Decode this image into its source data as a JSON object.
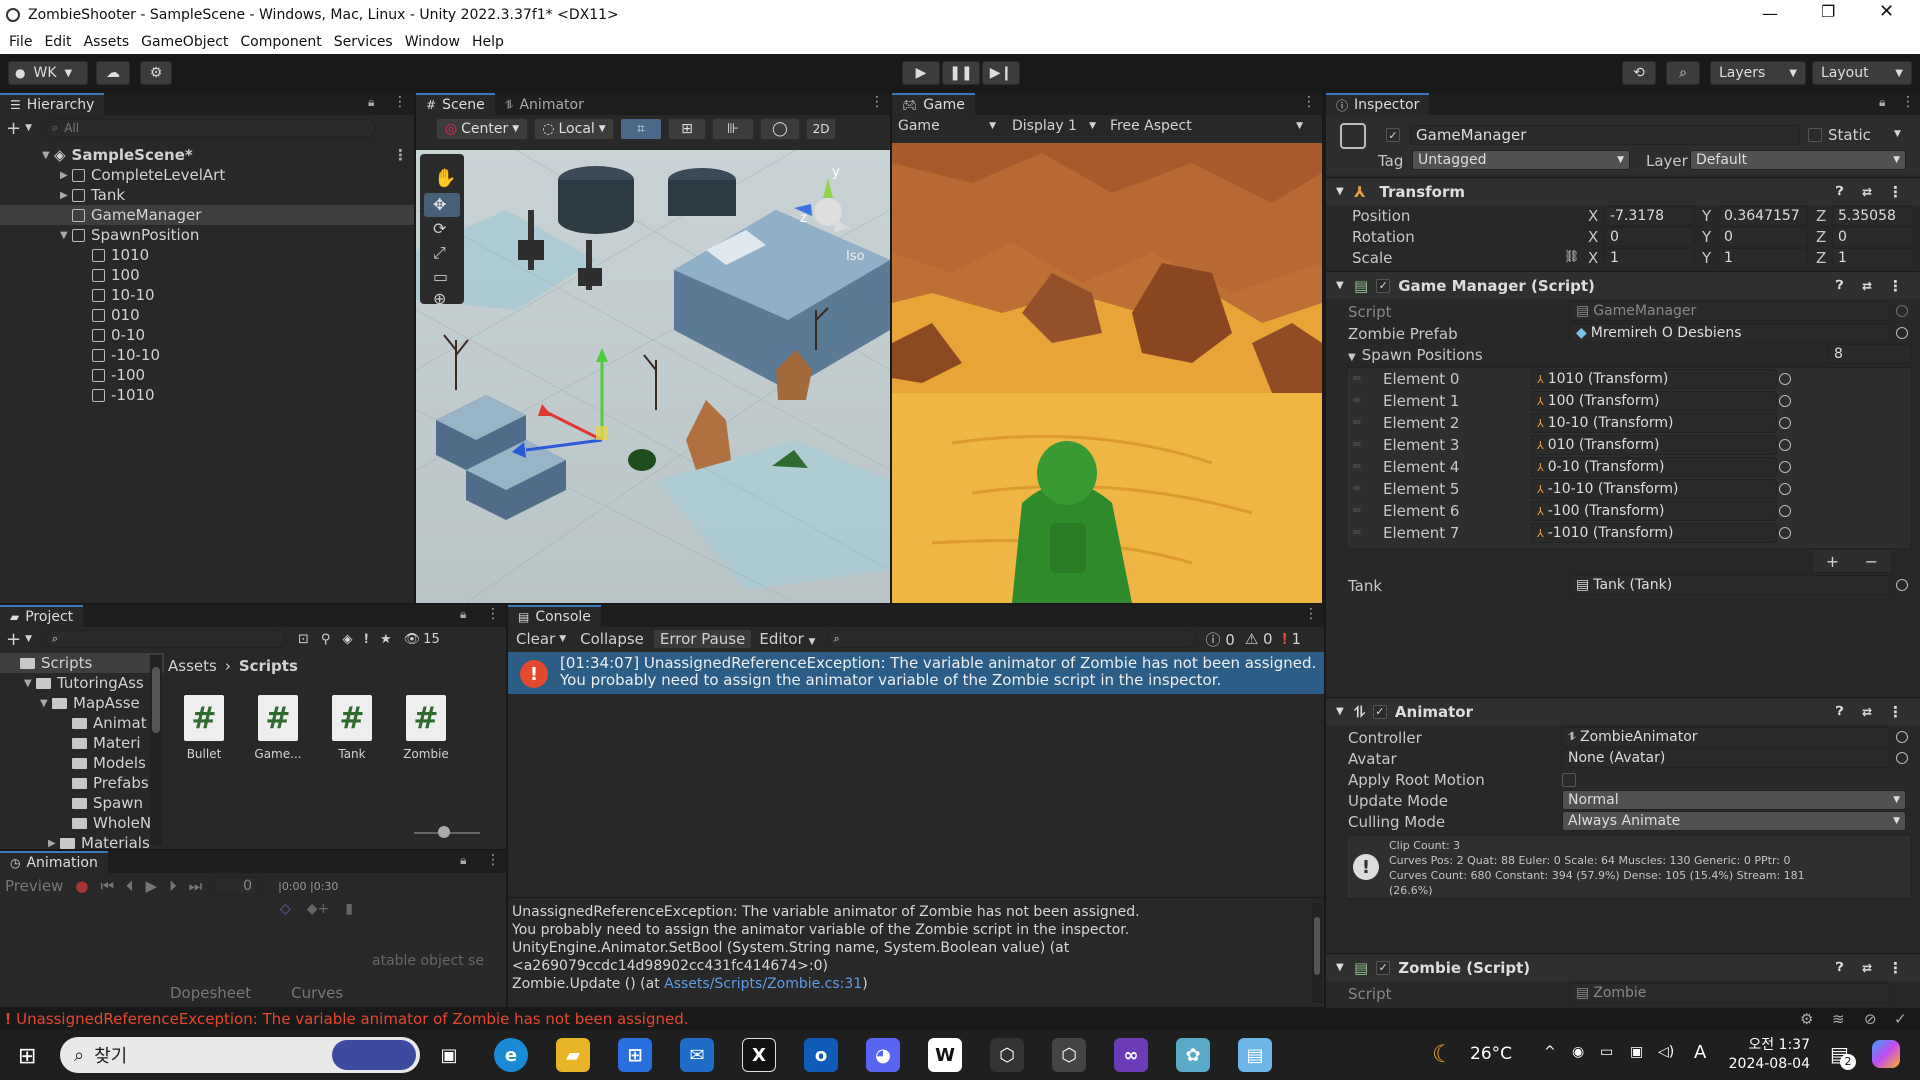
{
  "window": {
    "title": "ZombieShooter - SampleScene - Windows, Mac, Linux - Unity 2022.3.37f1* <DX11>"
  },
  "menu": [
    "File",
    "Edit",
    "Assets",
    "GameObject",
    "Component",
    "Services",
    "Window",
    "Help"
  ],
  "toolbar": {
    "account": "WK",
    "layers": "Layers",
    "layout": "Layout"
  },
  "hierarchy": {
    "tab": "Hierarchy",
    "search_placeholder": "All",
    "scene": "SampleScene*",
    "items": [
      "CompleteLevelArt",
      "Tank",
      "GameManager",
      "SpawnPosition"
    ],
    "children": [
      "1010",
      "100",
      "10-10",
      "010",
      "0-10",
      "-10-10",
      "-100",
      "-1010"
    ]
  },
  "scene": {
    "tab": "Scene",
    "tab2": "Animator",
    "pivot": "Center",
    "space": "Local",
    "mode2d": "2D",
    "iso": "Iso",
    "axis_y": "y",
    "axis_z": "z",
    "axis_x": "x"
  },
  "game": {
    "tab": "Game",
    "mode": "Game",
    "display": "Display 1",
    "aspect": "Free Aspect"
  },
  "inspector": {
    "tab": "Inspector",
    "object_name": "GameManager",
    "static_label": "Static",
    "tag_label": "Tag",
    "tag_value": "Untagged",
    "layer_label": "Layer",
    "layer_value": "Default",
    "transform": {
      "title": "Transform",
      "position_label": "Position",
      "rotation_label": "Rotation",
      "scale_label": "Scale",
      "x": "X",
      "y": "Y",
      "z": "Z",
      "position": [
        "-7.3178",
        "0.3647157",
        "5.35058"
      ],
      "rotation": [
        "0",
        "0",
        "0"
      ],
      "scale": [
        "1",
        "1",
        "1"
      ]
    },
    "gamemanager": {
      "title": "Game Manager (Script)",
      "script_label": "Script",
      "script_value": "GameManager",
      "prefab_label": "Zombie Prefab",
      "prefab_value": "Mremireh O Desbiens",
      "spawn_label": "Spawn Positions",
      "spawn_count": "8",
      "elements": [
        {
          "label": "Element 0",
          "value": "1010 (Transform)"
        },
        {
          "label": "Element 1",
          "value": "100 (Transform)"
        },
        {
          "label": "Element 2",
          "value": "10-10 (Transform)"
        },
        {
          "label": "Element 3",
          "value": "010 (Transform)"
        },
        {
          "label": "Element 4",
          "value": "0-10 (Transform)"
        },
        {
          "label": "Element 5",
          "value": "-10-10 (Transform)"
        },
        {
          "label": "Element 6",
          "value": "-100 (Transform)"
        },
        {
          "label": "Element 7",
          "value": "-1010 (Transform)"
        }
      ],
      "plus": "+",
      "minus": "−",
      "tank_label": "Tank",
      "tank_value": "Tank (Tank)"
    },
    "animator": {
      "title": "Animator",
      "controller_label": "Controller",
      "controller_value": "ZombieAnimator",
      "avatar_label": "Avatar",
      "avatar_value": "None (Avatar)",
      "root_label": "Apply Root Motion",
      "update_label": "Update Mode",
      "update_value": "Normal",
      "culling_label": "Culling Mode",
      "culling_value": "Always Animate",
      "info1": "Clip Count: 3",
      "info2": "Curves Pos: 2 Quat: 88 Euler: 0 Scale: 64 Muscles: 130 Generic: 0 PPtr: 0",
      "info3": "Curves Count: 680 Constant: 394 (57.9%) Dense: 105 (15.4%) Stream: 181",
      "info4": "(26.6%)"
    },
    "zombie": {
      "title": "Zombie (Script)",
      "script_label": "Script",
      "script_value": "Zombie"
    }
  },
  "project": {
    "tab": "Project",
    "hidden_count": "15",
    "tree": [
      "Scripts",
      "TutoringAss",
      "MapAsse",
      "Animat",
      "Materi",
      "Models",
      "Prefabs",
      "Spawn",
      "WholeN",
      "Materials"
    ],
    "breadcrumb_root": "Assets",
    "breadcrumb_sep": "›",
    "breadcrumb_leaf": "Scripts",
    "assets": [
      "Bullet",
      "Game...",
      "Tank",
      "Zombie"
    ],
    "asset_glyph": "#"
  },
  "animation": {
    "tab": "Animation",
    "preview": "Preview",
    "frame": "0",
    "t1": "0:00",
    "t2": "0:30",
    "message": "atable object se",
    "dopesheet": "Dopesheet",
    "curves": "Curves"
  },
  "console": {
    "tab": "Console",
    "clear": "Clear",
    "collapse": "Collapse",
    "error_pause": "Error Pause",
    "editor": "Editor",
    "count_log": "0",
    "count_warn": "0",
    "count_err": "1",
    "entry_line1": "[01:34:07] UnassignedReferenceException: The variable animator of Zombie has not been assigned.",
    "entry_line2": "You probably need to assign the animator variable of the Zombie script in the inspector.",
    "detail1": "UnassignedReferenceException: The variable animator of Zombie has not been assigned.",
    "detail2": "You probably need to assign the animator variable of the Zombie script in the inspector.",
    "detail3": "UnityEngine.Animator.SetBool (System.String name, System.Boolean value) (at",
    "detail4": "<a269079ccdc14d98902cc431fc414674>:0)",
    "detail5": "Zombie.Update () (at ",
    "detail5_link": "Assets/Scripts/Zombie.cs:31",
    "detail5_end": ")"
  },
  "statusbar": {
    "message": "UnassignedReferenceException: The variable animator of Zombie has not been assigned."
  },
  "taskbar": {
    "search": "찾기",
    "weather": "26°C",
    "time": "오전 1:37",
    "date": "2024-08-04",
    "ime": "A",
    "badge": "2"
  }
}
